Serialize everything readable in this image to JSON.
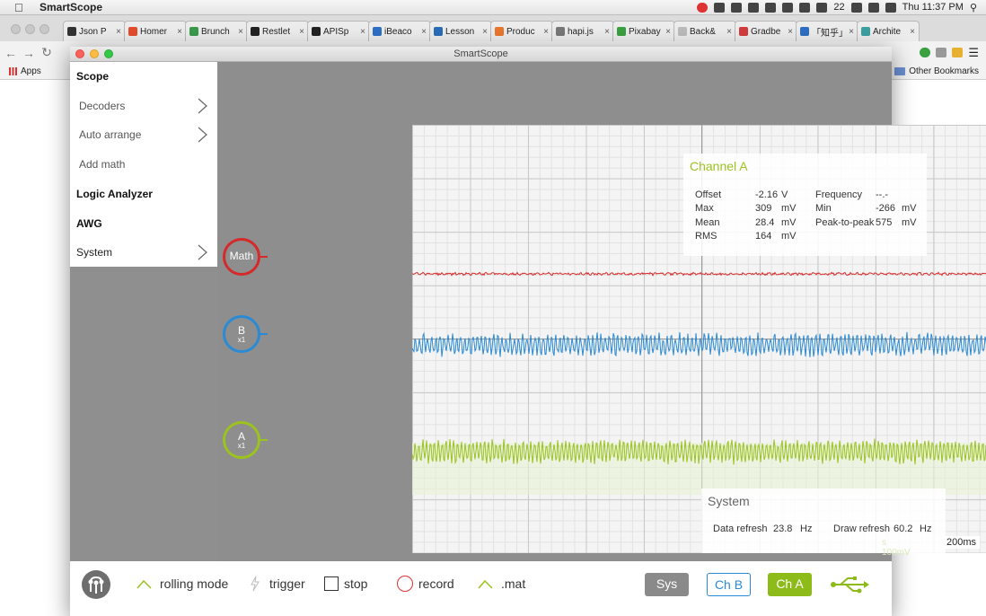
{
  "os_menubar": {
    "app_name": "SmartScope",
    "battery_text": "22",
    "clock": "Thu 11:37 PM"
  },
  "browser": {
    "tabs": [
      {
        "label": "Json P",
        "color": "#333333"
      },
      {
        "label": "Homer",
        "color": "#e34b2c"
      },
      {
        "label": "Brunch",
        "color": "#3a9a4a"
      },
      {
        "label": "Restlet",
        "color": "#222222"
      },
      {
        "label": "APISp",
        "color": "#222222"
      },
      {
        "label": "iBeaco",
        "color": "#2d6fc4"
      },
      {
        "label": "Lesson",
        "color": "#2a6cb8"
      },
      {
        "label": "Produc",
        "color": "#e8762c"
      },
      {
        "label": "hapi.js",
        "color": "#777777"
      },
      {
        "label": "Pixabay",
        "color": "#3aa040"
      },
      {
        "label": "Back&",
        "color": "#bbbbbb"
      },
      {
        "label": "Gradbe",
        "color": "#d33b3b"
      },
      {
        "label": "「知乎」",
        "color": "#2d6fc4"
      },
      {
        "label": "Archite",
        "color": "#3aa0a0"
      }
    ],
    "tab_close": "×",
    "bookmarks": {
      "apps_label": "Apps",
      "other_label": "Other Bookmarks"
    }
  },
  "window": {
    "title": "SmartScope"
  },
  "menu": {
    "items": [
      {
        "label": "Scope",
        "kind": "head",
        "chevron": false
      },
      {
        "label": "Decoders",
        "kind": "sub",
        "chevron": true
      },
      {
        "label": "Auto arrange",
        "kind": "sub",
        "chevron": true
      },
      {
        "label": "Add math",
        "kind": "sub",
        "chevron": false
      },
      {
        "label": "Logic Analyzer",
        "kind": "head",
        "chevron": false
      },
      {
        "label": "AWG",
        "kind": "head",
        "chevron": false
      },
      {
        "label": "System",
        "kind": "item",
        "chevron": true
      }
    ]
  },
  "channels": {
    "math": {
      "name": "Math",
      "scale": "",
      "color": "#d42a2a"
    },
    "b": {
      "name": "B",
      "scale": "x1",
      "color": "#2a8ad4"
    },
    "a": {
      "name": "A",
      "scale": "x1",
      "color": "#9cc21f"
    }
  },
  "channel_a_panel": {
    "title": "Channel A",
    "title_color": "#9cc21f",
    "measurements": [
      {
        "label": "Offset",
        "value": "-2.16",
        "unit": "V"
      },
      {
        "label": "Max",
        "value": "309",
        "unit": "mV"
      },
      {
        "label": "Mean",
        "value": "28.4",
        "unit": "mV"
      },
      {
        "label": "RMS",
        "value": "164",
        "unit": "mV"
      },
      {
        "label": "Frequency",
        "value": "--.-",
        "unit": ""
      },
      {
        "label": "Min",
        "value": "-266",
        "unit": "mV"
      },
      {
        "label": "Peak-to-peak",
        "value": "575",
        "unit": "mV"
      }
    ]
  },
  "system_panel": {
    "title": "System",
    "data_refresh": {
      "label": "Data refresh",
      "value": "23.8",
      "unit": "Hz"
    },
    "draw_refresh": {
      "label": "Draw refresh",
      "value": "60.2",
      "unit": "Hz"
    }
  },
  "timebase": "200ms",
  "faint_labels": [
    "s",
    "100mV"
  ],
  "toolbar": {
    "rolling_mode": "rolling mode",
    "trigger": "trigger",
    "stop": "stop",
    "record": "record",
    "mat": ".mat",
    "sys_btn": "Sys",
    "chb_btn": "Ch B",
    "cha_btn": "Ch A",
    "accent_green": "#8dbb1a",
    "accent_blue": "#2a8ad4",
    "sys_gray": "#8a8a8a"
  }
}
